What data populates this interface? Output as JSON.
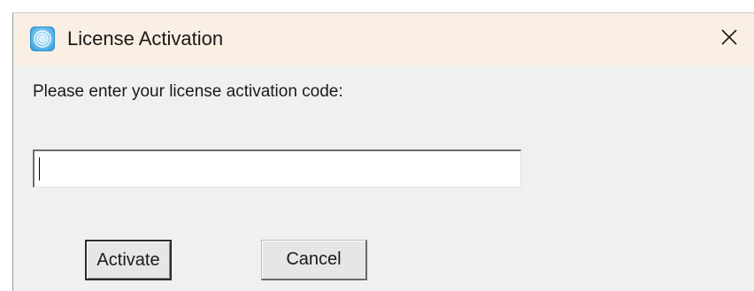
{
  "window": {
    "title": "License Activation",
    "icon": "app-logo-icon",
    "close_icon": "close-icon",
    "colors": {
      "titlebar": "#f9efe3",
      "body": "#f0f0f0"
    }
  },
  "form": {
    "prompt": "Please enter your license activation code:",
    "code_value": "",
    "code_placeholder": ""
  },
  "buttons": {
    "activate_label": "Activate",
    "cancel_label": "Cancel"
  }
}
